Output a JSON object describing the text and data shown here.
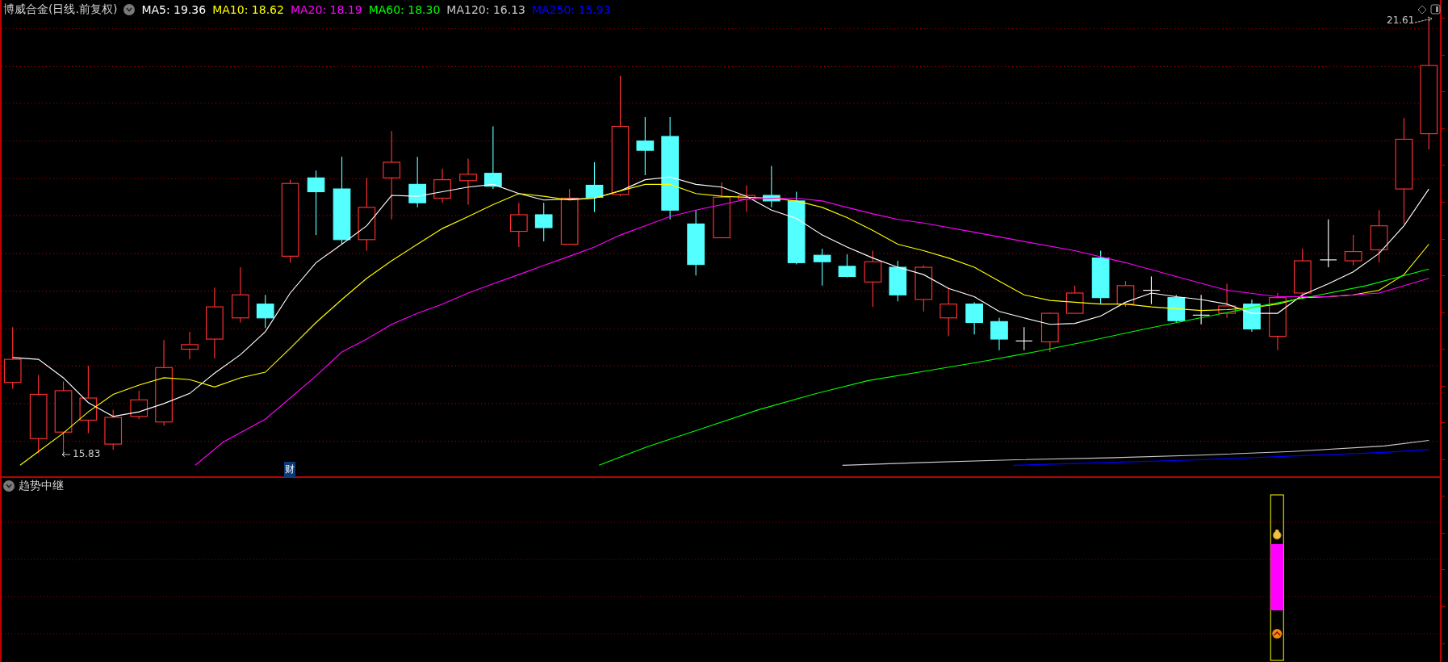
{
  "main_panel": {
    "title": "博威合金(日线.前复权)",
    "indicators": [
      {
        "label": "MA5: 19.36",
        "color": "#ffffff"
      },
      {
        "label": "MA10: 18.62",
        "color": "#ffff00"
      },
      {
        "label": "MA20: 18.19",
        "color": "#ff00ff"
      },
      {
        "label": "MA60: 18.30",
        "color": "#00ff00"
      },
      {
        "label": "MA120: 16.13",
        "color": "#c8c8c8"
      },
      {
        "label": "MA250: 15.93",
        "color": "#0000ff"
      }
    ],
    "high_label": "21.61",
    "low_label": "15.83",
    "badge": "财"
  },
  "sub_panel": {
    "title": "趋势中继"
  }
}
